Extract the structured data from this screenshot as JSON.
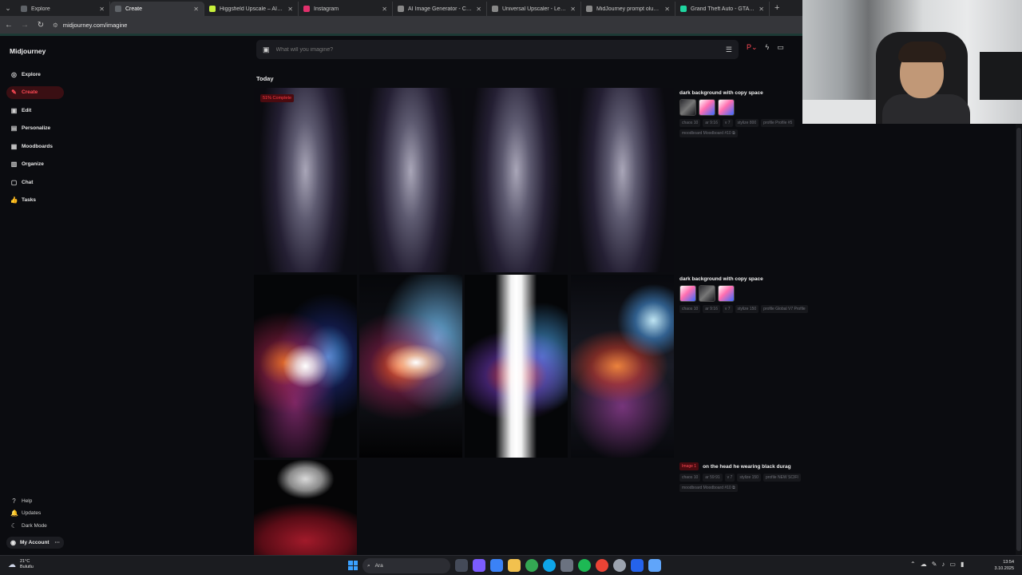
{
  "browser": {
    "tabs": [
      {
        "title": "Explore",
        "color": "#5f6368"
      },
      {
        "title": "Create",
        "color": "#5f6368",
        "active": true
      },
      {
        "title": "Higgsfield Upscale – AI Image U...",
        "color": "#c7f03b"
      },
      {
        "title": "Instagram",
        "color": "#e1306c"
      },
      {
        "title": "AI Image Generator - Create Art...",
        "color": "#888888"
      },
      {
        "title": "Universal Upscaler - Leonardo.A...",
        "color": "#888888"
      },
      {
        "title": "MidJourney prompt oluşturma",
        "color": "#888888"
      },
      {
        "title": "Grand Theft Auto - GTA Font G...",
        "color": "#1fd6a0"
      }
    ],
    "url": "midjourney.com/imagine"
  },
  "sidebar": {
    "logo": "Midjourney",
    "items": [
      {
        "label": "Explore",
        "icon": "compass-icon",
        "glyph": "◎"
      },
      {
        "label": "Create",
        "icon": "paintbrush-icon",
        "glyph": "✎",
        "active": true
      },
      {
        "label": "Edit",
        "icon": "edit-icon",
        "glyph": "▣"
      },
      {
        "label": "Personalize",
        "icon": "personalize-icon",
        "glyph": "▤"
      },
      {
        "label": "Moodboards",
        "icon": "moodboard-icon",
        "glyph": "▦"
      },
      {
        "label": "Organize",
        "icon": "folder-icon",
        "glyph": "▥"
      },
      {
        "label": "Chat",
        "icon": "chat-icon",
        "glyph": "▢"
      },
      {
        "label": "Tasks",
        "icon": "thumbs-up-icon",
        "glyph": "👍"
      }
    ],
    "bottom": [
      {
        "label": "Help",
        "icon": "help-icon",
        "glyph": "?"
      },
      {
        "label": "Updates",
        "icon": "bell-icon",
        "glyph": "🔔"
      },
      {
        "label": "Dark Mode",
        "icon": "moon-icon",
        "glyph": "☾"
      }
    ],
    "account": "My Account",
    "account_more": "···"
  },
  "prompt": {
    "placeholder": "What will you imagine?"
  },
  "feed": {
    "section_title": "Today",
    "pending_badge": "51% Complete",
    "jobs": [
      {
        "prompt": "dark background with copy space",
        "tags": [
          "chaos 10",
          "ar 9:16",
          "v 7",
          "stylize 800",
          "profile Profile #5"
        ],
        "tags2": [
          "moodboard Moodboard #10 ⧉"
        ]
      },
      {
        "prompt": "dark background with copy space",
        "tags": [
          "chaos 10",
          "ar 9:16",
          "v 7",
          "stylize 150",
          "profile Global V7 Profile"
        ]
      },
      {
        "prompt_prefix": "Image 1",
        "prompt": "on the head he wearing black durag",
        "tags": [
          "chaos 10",
          "ar 59:91",
          "v 7",
          "stylize 150",
          "profile NEW SCIFI"
        ],
        "tags2": [
          "moodboard Moodboard #10 ⧉"
        ]
      }
    ]
  },
  "taskbar": {
    "weather_temp": "21°C",
    "weather_desc": "Bulutlu",
    "search": "Ara",
    "time": "13:54",
    "date": "3.10.2025"
  },
  "colors": {
    "accent": "#ff4a55",
    "background": "#0b0c10"
  }
}
